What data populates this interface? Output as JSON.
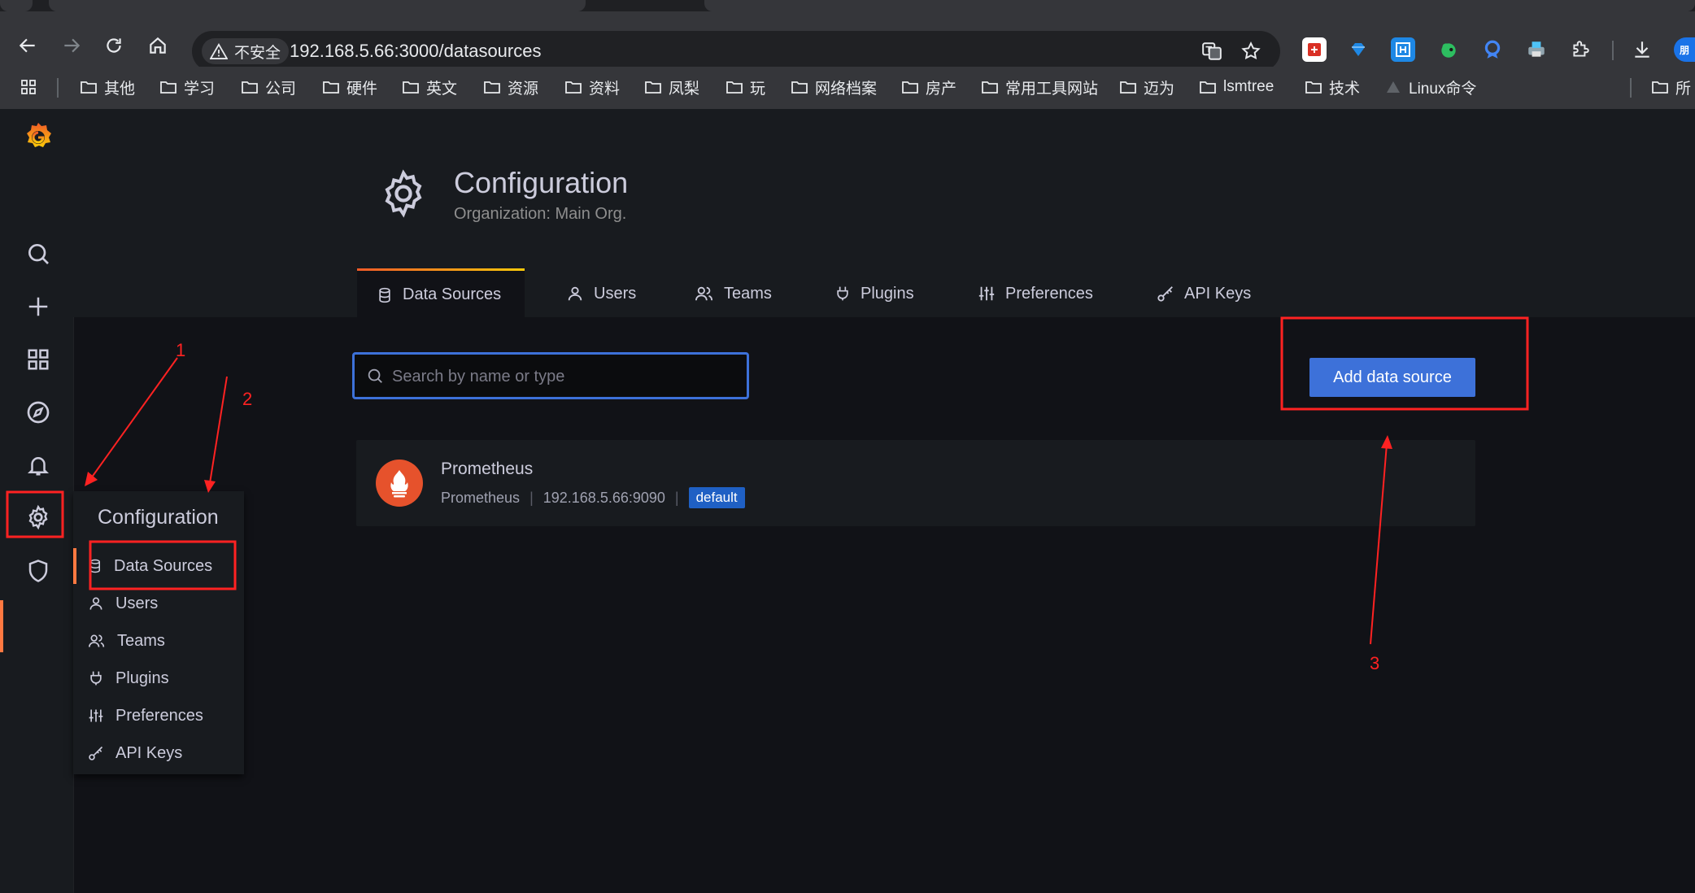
{
  "browser": {
    "security_label": "不安全",
    "url": "192.168.5.66:3000/datasources",
    "ext_badge": "朋",
    "bookmarks": [
      {
        "label": "其他"
      },
      {
        "label": "学习"
      },
      {
        "label": "公司"
      },
      {
        "label": "硬件"
      },
      {
        "label": "英文"
      },
      {
        "label": "资源"
      },
      {
        "label": "资料"
      },
      {
        "label": "凤梨"
      },
      {
        "label": "玩"
      },
      {
        "label": "网络档案"
      },
      {
        "label": "房产"
      },
      {
        "label": "常用工具网站"
      },
      {
        "label": "迈为"
      },
      {
        "label": "lsmtree"
      },
      {
        "label": "技术"
      },
      {
        "label": "Linux命令"
      },
      {
        "label": "所"
      }
    ]
  },
  "header": {
    "title": "Configuration",
    "subtitle": "Organization: Main Org."
  },
  "tabs": [
    {
      "label": "Data Sources",
      "icon": "database-icon",
      "active": true
    },
    {
      "label": "Users",
      "icon": "user-icon"
    },
    {
      "label": "Teams",
      "icon": "users-icon"
    },
    {
      "label": "Plugins",
      "icon": "plug-icon"
    },
    {
      "label": "Preferences",
      "icon": "sliders-icon"
    },
    {
      "label": "API Keys",
      "icon": "key-icon"
    }
  ],
  "search": {
    "placeholder": "Search by name or type"
  },
  "add_button": {
    "label": "Add data source"
  },
  "datasource": {
    "name": "Prometheus",
    "type": "Prometheus",
    "url": "192.168.5.66:9090",
    "badge": "default"
  },
  "flyout": {
    "title": "Configuration",
    "items": [
      {
        "label": "Data Sources"
      },
      {
        "label": "Users"
      },
      {
        "label": "Teams"
      },
      {
        "label": "Plugins"
      },
      {
        "label": "Preferences"
      },
      {
        "label": "API Keys"
      }
    ]
  },
  "annotations": {
    "a1": "1",
    "a2": "2",
    "a3": "3"
  },
  "colors": {
    "accent": "#3d71d9",
    "brand": "#f05a28",
    "annotation": "#ff2222",
    "background": "#111217"
  }
}
